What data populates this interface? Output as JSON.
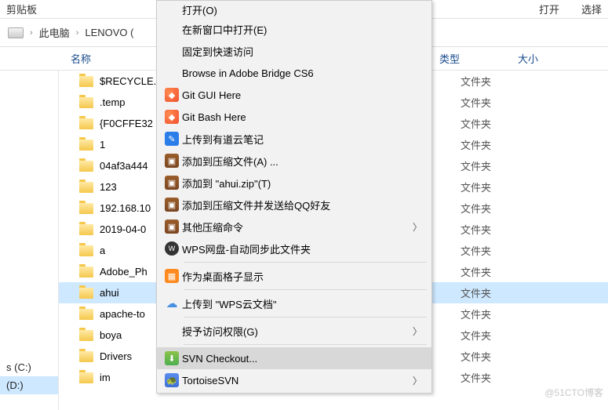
{
  "topbar": {
    "clipboard": "剪贴板",
    "open": "打开",
    "select": "选择"
  },
  "addr": {
    "pc": "此电脑",
    "drive": "LENOVO ("
  },
  "columns": {
    "name": "名称",
    "type": "类型",
    "size": "大小"
  },
  "type_label": "文件夹",
  "files": [
    {
      "name": "$RECYCLE."
    },
    {
      "name": ".temp"
    },
    {
      "name": "{F0CFFE32"
    },
    {
      "name": "1"
    },
    {
      "name": "04af3a444"
    },
    {
      "name": "123"
    },
    {
      "name": "192.168.10"
    },
    {
      "name": "2019-04-0"
    },
    {
      "name": "a"
    },
    {
      "name": "Adobe_Ph"
    },
    {
      "name": "ahui",
      "selected": true
    },
    {
      "name": "apache-to"
    },
    {
      "name": "boya"
    },
    {
      "name": "Drivers"
    },
    {
      "name": "im"
    }
  ],
  "sidebar": {
    "c": "s (C:)",
    "d": "(D:)"
  },
  "ctx": {
    "cut_top": "打开(O)",
    "items": [
      {
        "label": "在新窗口中打开(E)",
        "icon": ""
      },
      {
        "label": "固定到快速访问",
        "icon": ""
      },
      {
        "label": "Browse in Adobe Bridge CS6",
        "icon": ""
      },
      {
        "label": "Git GUI Here",
        "icon": "git"
      },
      {
        "label": "Git Bash Here",
        "icon": "git"
      },
      {
        "label": "上传到有道云笔记",
        "icon": "note"
      },
      {
        "label": "添加到压缩文件(A) ...",
        "icon": "rar"
      },
      {
        "label": "添加到 \"ahui.zip\"(T)",
        "icon": "rar"
      },
      {
        "label": "添加到压缩文件并发送给QQ好友",
        "icon": "rar"
      },
      {
        "label": "其他压缩命令",
        "icon": "rar",
        "sub": true
      },
      {
        "label": "WPS网盘-自动同步此文件夹",
        "icon": "wps"
      },
      {
        "sep": true
      },
      {
        "label": "作为桌面格子显示",
        "icon": "grid"
      },
      {
        "sep": true
      },
      {
        "label": "上传到 \"WPS云文档\"",
        "icon": "cloud"
      },
      {
        "sep": true
      },
      {
        "label": "授予访问权限(G)",
        "icon": "",
        "sub": true
      },
      {
        "sep": true
      },
      {
        "label": "SVN Checkout...",
        "icon": "svn",
        "hov": true
      },
      {
        "label": "TortoiseSVN",
        "icon": "tort",
        "sub": true
      }
    ]
  },
  "watermark": "@51CTO博客"
}
